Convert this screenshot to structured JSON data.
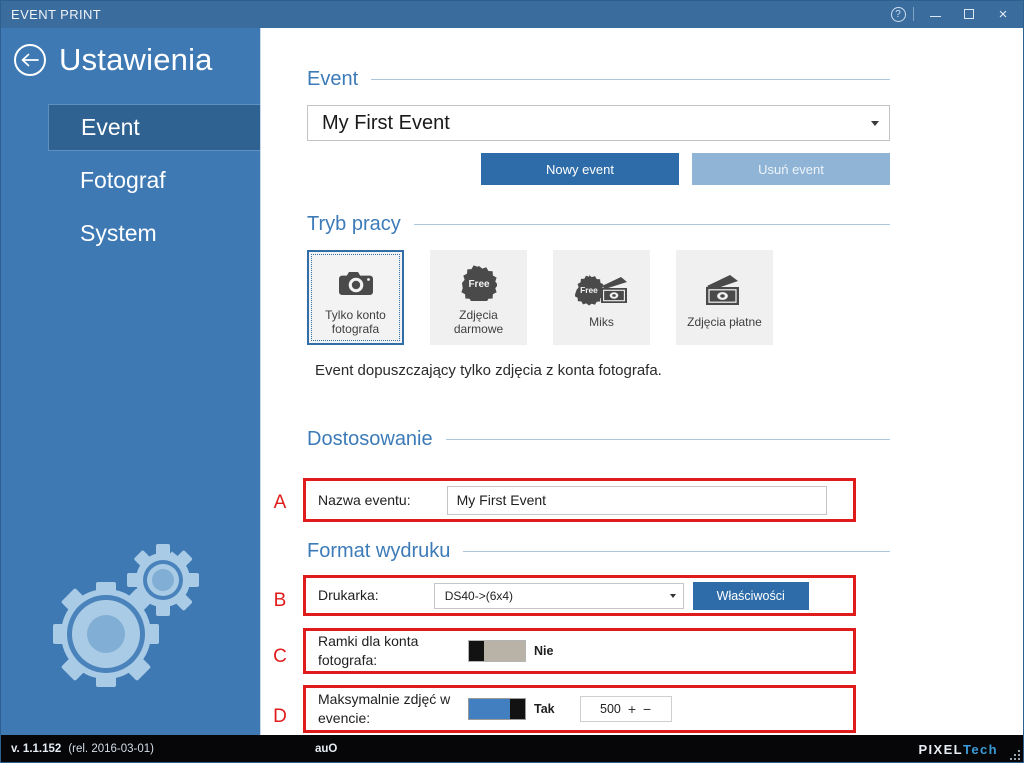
{
  "window": {
    "title": "EVENT PRINT",
    "controls": {
      "help": "?",
      "minimize": "minimize-icon",
      "maximize": "maximize-icon",
      "close": "×"
    }
  },
  "sidebar": {
    "back_icon": "back-arrow-icon",
    "title": "Ustawienia",
    "items": [
      {
        "label": "Event",
        "active": true
      },
      {
        "label": "Fotograf",
        "active": false
      },
      {
        "label": "System",
        "active": false
      }
    ],
    "watermark_icon": "gears-icon"
  },
  "main": {
    "event_section": {
      "heading": "Event",
      "event_select_value": "My First Event",
      "buttons": {
        "new": "Nowy event",
        "delete": "Usuń event"
      }
    },
    "mode_section": {
      "heading": "Tryb pracy",
      "cards": [
        {
          "label": "Tylko konto\nfotografa",
          "icon": "camera-icon",
          "selected": true
        },
        {
          "label": "Zdjęcia\ndarmowe",
          "icon": "free-badge-icon",
          "selected": false
        },
        {
          "label": "Miks",
          "icon": "free-badge-and-money-icon",
          "selected": false
        },
        {
          "label": "Zdjęcia płatne",
          "icon": "money-icon",
          "selected": false
        }
      ],
      "description": "Event dopuszczający tylko zdjęcia z konta fotografa."
    },
    "customization_section": {
      "heading": "Dostosowanie",
      "row_marker": "A",
      "name_label": "Nazwa eventu:",
      "name_value": "My First Event"
    },
    "print_section": {
      "heading": "Format wydruku",
      "rows": [
        {
          "marker": "B",
          "label": "Drukarka:",
          "value": "DS40->(6x4)",
          "button": "Właściwości"
        },
        {
          "marker": "C",
          "label": "Ramki dla konta\nfotografa:",
          "toggle_state": "off",
          "toggle_text": "Nie"
        },
        {
          "marker": "D",
          "label": "Maksymalnie zdjęć w\nevencie:",
          "toggle_state": "on",
          "toggle_text": "Tak",
          "spinner_value": "500",
          "spin_up": "+",
          "spin_down": "−"
        }
      ]
    }
  },
  "statusbar": {
    "version": "v. 1.1.152",
    "release": "(rel. 2016-03-01)",
    "middle": "auO",
    "logo_primary": "PIXEL",
    "logo_secondary": "Tech"
  },
  "colors": {
    "titlebar": "#3b6c9e",
    "sidebar": "#3e79b4",
    "sidebar_active": "#2f6191",
    "accent": "#2d6ca8",
    "heading": "#3c7bb8",
    "highlight": "#e01b1b",
    "statusbar": "#060608"
  }
}
